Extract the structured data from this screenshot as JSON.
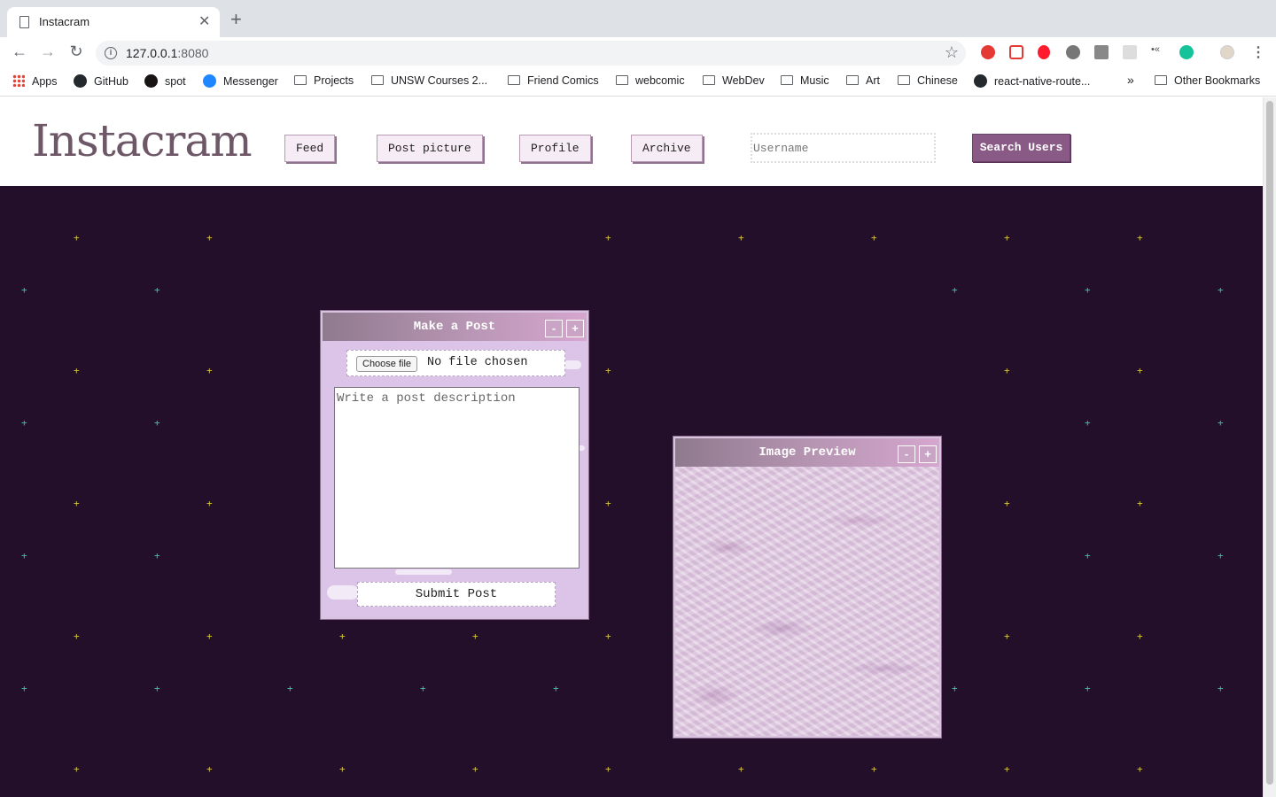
{
  "browser": {
    "tab_title": "Instacram",
    "url_host": "127.0.0.1",
    "url_port": ":8080",
    "bookmarks": [
      {
        "label": "Apps",
        "icon": "apps-grid-icon"
      },
      {
        "label": "GitHub",
        "icon": "github-icon"
      },
      {
        "label": "spot",
        "icon": "spotify-icon"
      },
      {
        "label": "Messenger",
        "icon": "messenger-icon"
      },
      {
        "label": "Projects",
        "icon": "folder-icon"
      },
      {
        "label": "UNSW Courses 2...",
        "icon": "folder-icon"
      },
      {
        "label": "Friend Comics",
        "icon": "folder-icon"
      },
      {
        "label": "webcomic",
        "icon": "folder-icon"
      },
      {
        "label": "WebDev",
        "icon": "folder-icon"
      },
      {
        "label": "Music",
        "icon": "folder-icon"
      },
      {
        "label": "Art",
        "icon": "folder-icon"
      },
      {
        "label": "Chinese",
        "icon": "folder-icon"
      },
      {
        "label": "react-native-route...",
        "icon": "github-icon"
      },
      {
        "label": "»",
        "icon": "overflow-chevron-icon"
      },
      {
        "label": "Other Bookmarks",
        "icon": "folder-icon"
      }
    ]
  },
  "header": {
    "logo": "Instacram",
    "nav": [
      "Feed",
      "Post picture",
      "Profile",
      "Archive"
    ],
    "search_placeholder": "Username",
    "search_button": "Search Users"
  },
  "post_window": {
    "title": "Make a Post",
    "minimize": "-",
    "maximize": "+",
    "choose_file": "Choose file",
    "no_file": "No file chosen",
    "description_placeholder": "Write a post description",
    "submit": "Submit Post"
  },
  "preview_window": {
    "title": "Image Preview",
    "minimize": "-",
    "maximize": "+"
  },
  "colors": {
    "background": "#230f2a",
    "accent": "#8a5a86",
    "window_body": "#dcc3e8"
  }
}
